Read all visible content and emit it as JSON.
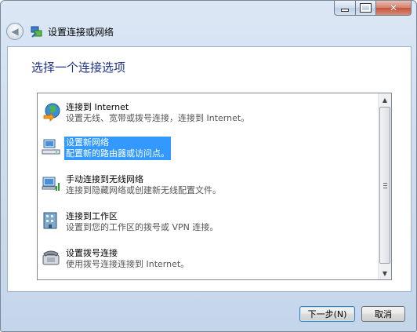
{
  "window": {
    "title": "设置连接或网络",
    "colors": {
      "accent": "#3399ff",
      "heading": "#1e3287"
    }
  },
  "caption_buttons": {
    "minimize_icon": "minimize-icon",
    "maximize_icon": "maximize-icon",
    "close_icon": "close-icon",
    "close_glyph": "✕"
  },
  "navbar": {
    "back_icon": "back-arrow-icon",
    "back_glyph": "◀"
  },
  "main": {
    "heading": "选择一个连接选项",
    "options": [
      {
        "title": "连接到 Internet",
        "desc": "设置无线、宽带或拨号连接，连接到 Internet。",
        "icon": "globe-internet-icon",
        "selected": false
      },
      {
        "title": "设置新网络",
        "desc": "配置新的路由器或访问点。",
        "icon": "network-router-icon",
        "selected": true
      },
      {
        "title": "手动连接到无线网络",
        "desc": "连接到隐藏网络或创建新无线配置文件。",
        "icon": "wireless-network-icon",
        "selected": false
      },
      {
        "title": "连接到工作区",
        "desc": "设置到您的工作区的拨号或 VPN 连接。",
        "icon": "workplace-building-icon",
        "selected": false
      },
      {
        "title": "设置拨号连接",
        "desc": "使用拨号连接连接到 Internet。",
        "icon": "dialup-phone-icon",
        "selected": false
      }
    ]
  },
  "scrollbar": {
    "up_glyph": "▲",
    "down_glyph": "▼"
  },
  "footer": {
    "next_label": "下一步(N)",
    "cancel_label": "取消"
  }
}
